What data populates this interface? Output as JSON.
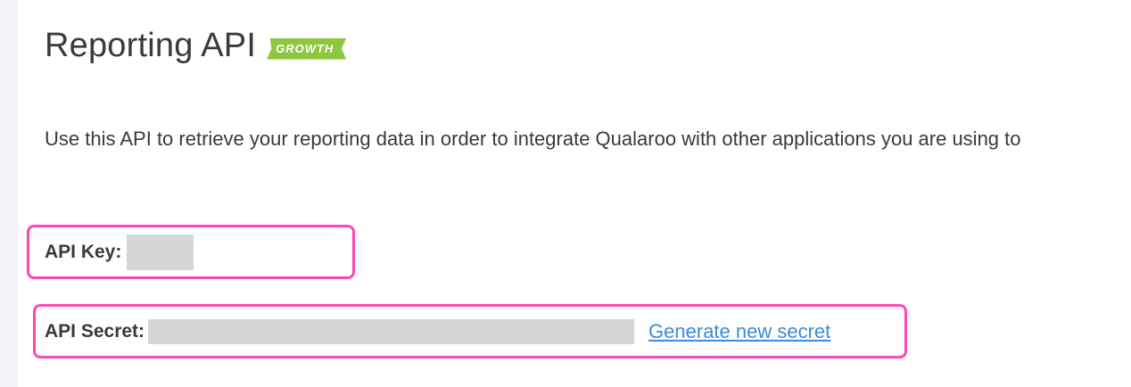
{
  "header": {
    "title": "Reporting API",
    "badge": "GROWTH"
  },
  "description": "Use this API to retrieve your reporting data in order to integrate Qualaroo with other applications you are using to",
  "fields": {
    "api_key": {
      "label": "API Key:",
      "value_state": "redacted"
    },
    "api_secret": {
      "label": "API Secret:",
      "value_state": "redacted",
      "action_label": "Generate new secret"
    }
  },
  "colors": {
    "badge": "#8dc63f",
    "highlight_border": "#ff47b8",
    "link": "#3a8dd6",
    "redacted": "#d6d6d6",
    "left_rail": "#f1f2f6"
  }
}
